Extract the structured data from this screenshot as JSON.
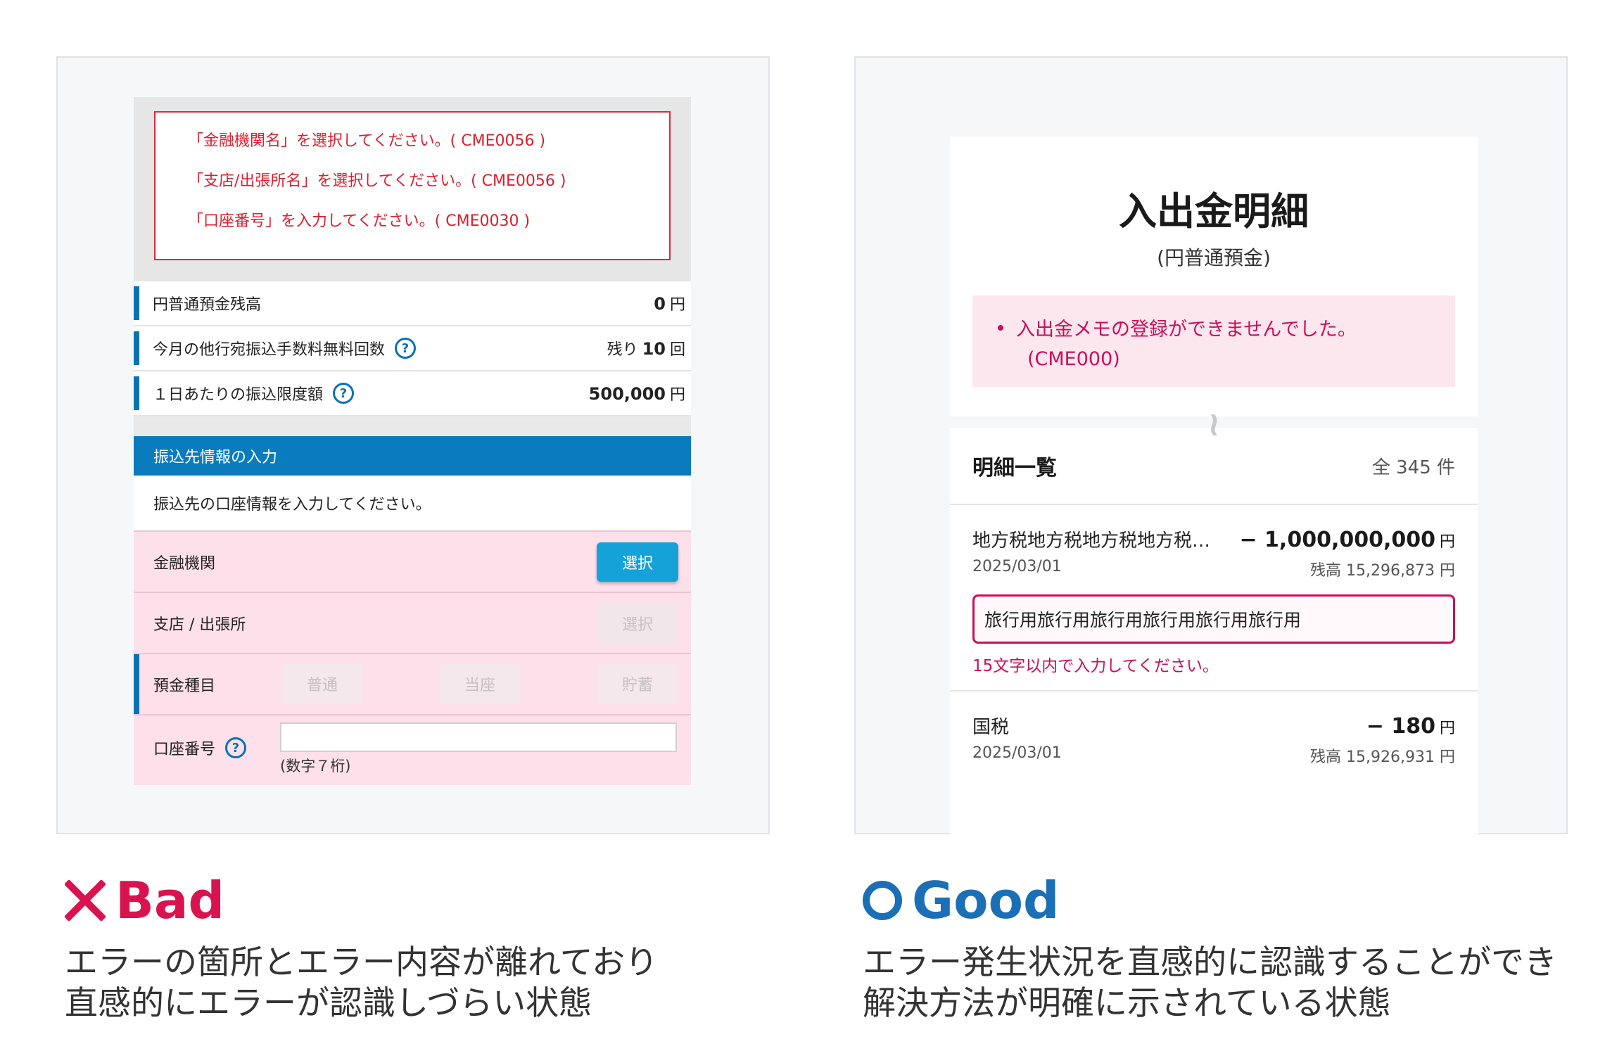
{
  "bad": {
    "errors": [
      "「金融機関名」を選択してください。( CME0056 )",
      "「支店/出張所名」を選択してください。( CME0056 )",
      "「口座番号」を入力してください。( CME0030 )"
    ],
    "balance_label": "円普通預金残高",
    "balance_value": "0",
    "balance_unit": "円",
    "free_count_label": "今月の他行宛振込手数料無料回数",
    "free_count_prefix": "残り",
    "free_count_value": "10",
    "free_count_unit": "回",
    "limit_label": "１日あたりの振込限度額",
    "limit_value": "500,000",
    "limit_unit": "円",
    "help_glyph": "?",
    "section_title": "振込先情報の入力",
    "section_desc": "振込先の口座情報を入力してください。",
    "bank_label": "金融機関",
    "bank_button": "選択",
    "branch_label": "支店 / 出張所",
    "branch_button": "選択",
    "type_label": "預金種目",
    "types": [
      "普通",
      "当座",
      "貯蓄"
    ],
    "account_label": "口座番号",
    "account_hint": "(数字７桁)"
  },
  "good": {
    "title": "入出金明細",
    "subtitle": "(円普通預金)",
    "alert_line1": "入出金メモの登録ができませんでした。",
    "alert_line2": "(CME000)",
    "list_title": "明細一覧",
    "list_count": "全 345 件",
    "items": [
      {
        "name": "地方税地方税地方税地方税…",
        "amount": "− 1,000,000,000",
        "unit": "円",
        "date": "2025/03/01",
        "balance": "残高 15,296,873 円",
        "memo": "旅行用旅行用旅行用旅行用旅行用旅行用",
        "memo_error": "15文字以内で入力してください。"
      },
      {
        "name": "国税",
        "amount": "− 180",
        "unit": "円",
        "date": "2025/03/01",
        "balance": "残高 15,926,931 円"
      }
    ]
  },
  "captions": {
    "bad_label": "Bad",
    "bad_text_1": "エラーの箇所とエラー内容が離れており",
    "bad_text_2": "直感的にエラーが認識しづらい状態",
    "good_label": "Good",
    "good_text_1": "エラー発生状況を直感的に認識することができ",
    "good_text_2": "解決方法が明確に示されている状態"
  },
  "colors": {
    "bad": "#d9134f",
    "good": "#1b6fb6",
    "error_red": "#d8202e",
    "magenta": "#c8105a",
    "blue": "#0a72b2"
  },
  "icons": {
    "bad": "x-mark-icon",
    "good": "circle-mark-icon",
    "help": "help-circle-icon",
    "wave": "wave-break-icon"
  }
}
